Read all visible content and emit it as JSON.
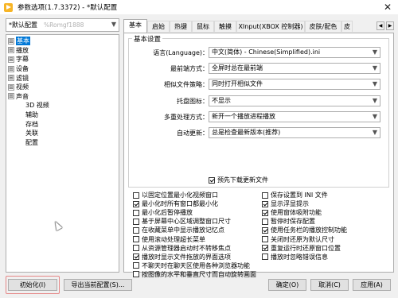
{
  "window": {
    "title": "参数选项(1.7.3372) - *默认配置",
    "close_glyph": "✕"
  },
  "sidebar": {
    "profile": {
      "value": "*默认配置",
      "hint": "%Romgf1888"
    },
    "tree": [
      {
        "label": "基本",
        "expander": "⊞",
        "selected": true
      },
      {
        "label": "播放",
        "expander": "⊞"
      },
      {
        "label": "字幕",
        "expander": "⊞"
      },
      {
        "label": "设备",
        "expander": "⊞"
      },
      {
        "label": "滤镜",
        "expander": "⊞"
      },
      {
        "label": "视频",
        "expander": "⊞"
      },
      {
        "label": "声音",
        "expander": "⊞"
      },
      {
        "label": "3D 视频"
      },
      {
        "label": "辅助"
      },
      {
        "label": "存档"
      },
      {
        "label": "关联"
      },
      {
        "label": "配置"
      }
    ]
  },
  "tabs": [
    "基本",
    "启始",
    "热键",
    "鼠标",
    "触摸",
    "XInput(XBOX 控制器)",
    "皮肤/配色",
    "皮"
  ],
  "tab_nav": {
    "prev": "◀",
    "next": "▶"
  },
  "basic": {
    "group_title": "基本设置",
    "rows": [
      {
        "label": "语言(Language)：",
        "value": "中文(简体) - Chinese(Simplified).ini"
      },
      {
        "label": "最前端方式：",
        "value": "全屏时总在最前端"
      },
      {
        "label": "相似文件策略：",
        "value": "同时打开相似文件"
      },
      {
        "label": "托盘图标：",
        "value": "不显示"
      },
      {
        "label": "多重处理方式：",
        "value": "新开一个播放进程播放"
      },
      {
        "label": "自动更新：",
        "value": "总是检查最新版本(推荐)"
      }
    ],
    "predownload": {
      "label": "预先下载更新文件",
      "checked": true
    }
  },
  "checkboxes": [
    {
      "label": "以固定位置最小化视频窗口",
      "checked": false
    },
    {
      "label": "保存设置到 INI 文件",
      "checked": false
    },
    {
      "label": "最小化时所有窗口都最小化",
      "checked": true
    },
    {
      "label": "显示浮显提示",
      "checked": true
    },
    {
      "label": "最小化后暂停播放",
      "checked": false
    },
    {
      "label": "使用窗体吸附功能",
      "checked": true
    },
    {
      "label": "基于屏幕中心区域调整窗口尺寸",
      "checked": false
    },
    {
      "label": "暂停时保存配置",
      "checked": false
    },
    {
      "label": "在收藏菜单中显示播放记忆点",
      "checked": false
    },
    {
      "label": "使用任务栏的播放控制功能",
      "checked": true
    },
    {
      "label": "使用滚动处理超长菜单",
      "checked": false
    },
    {
      "label": "关闭时还原为默认尺寸",
      "checked": false
    },
    {
      "label": "从资源管理器启动时不转移焦点",
      "checked": false
    },
    {
      "label": "重复运行时还原窗口位置",
      "checked": true
    },
    {
      "label": "播放时显示文件拖放的界面选项",
      "checked": true
    },
    {
      "label": "播放时忽略错误信息",
      "checked": false
    },
    {
      "label": "不聊天时在聊天区使用各种浏览器功能",
      "checked": false
    },
    {
      "label": "按图像的水平和垂直尺寸而自动旋转画面",
      "checked": false
    }
  ],
  "buttons": {
    "init": "初始化(I)",
    "export": "导出当前配置(S)...",
    "ok": "确定(O)",
    "cancel": "取消(C)",
    "apply": "应用(A)"
  },
  "colors": {
    "selection": "#0078d7",
    "highlight_border": "#e58787",
    "app_icon": "#f7b526"
  }
}
